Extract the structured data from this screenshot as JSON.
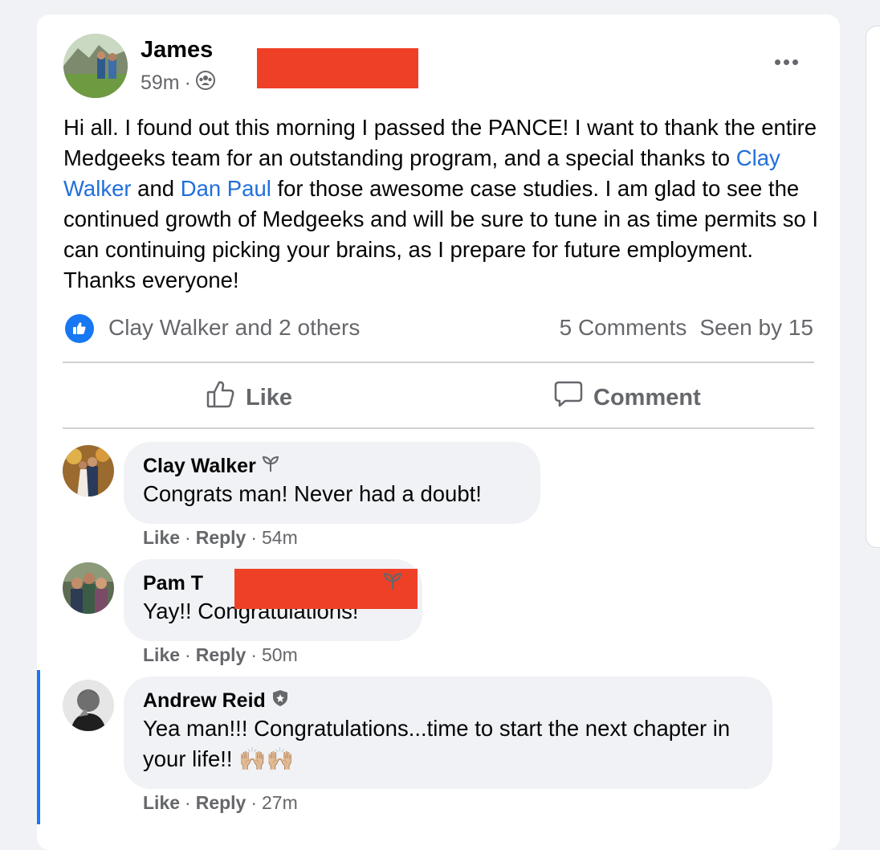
{
  "post": {
    "author": "James",
    "time": "59m",
    "separator": "·",
    "text_parts": [
      "Hi all. I found out this morning I passed the PANCE! I want to thank the entire Medgeeks team for an outstanding program, and a special thanks to ",
      "Clay Walker",
      " and ",
      "Dan Paul",
      " for those awesome case studies. I am glad to see the continued growth of Medgeeks and will be sure to tune in as time permits so I can continuing picking your brains, as I prepare for future employment. Thanks everyone!"
    ],
    "reactions": "Clay Walker and 2 others",
    "comments_count": "5 Comments",
    "seen_by": "Seen by 15"
  },
  "actions": {
    "like": "Like",
    "comment": "Comment"
  },
  "comments": [
    {
      "name": "Clay Walker",
      "text": "Congrats man! Never had a doubt!",
      "like": "Like",
      "reply": "Reply",
      "time": "54m",
      "sep": "·"
    },
    {
      "name": "Pam T",
      "text": "Yay!! Congratulations!",
      "like": "Like",
      "reply": "Reply",
      "time": "50m",
      "sep": "·"
    },
    {
      "name": "Andrew Reid",
      "text": "Yea man!!! Congratulations...time to start the next chapter in your life!! 🙌🏼🙌🏼",
      "like": "Like",
      "reply": "Reply",
      "time": "27m",
      "sep": "·"
    }
  ],
  "colors": {
    "accent": "#1877f2",
    "mention": "#216fdb",
    "redaction": "#ee4026",
    "secondary_text": "#65676b"
  },
  "icons": [
    "group-audience-icon",
    "more-options-icon",
    "like-reaction-icon",
    "like-icon",
    "comment-icon",
    "rising-star-icon",
    "admin-shield-icon",
    "raised-hands-emoji"
  ]
}
